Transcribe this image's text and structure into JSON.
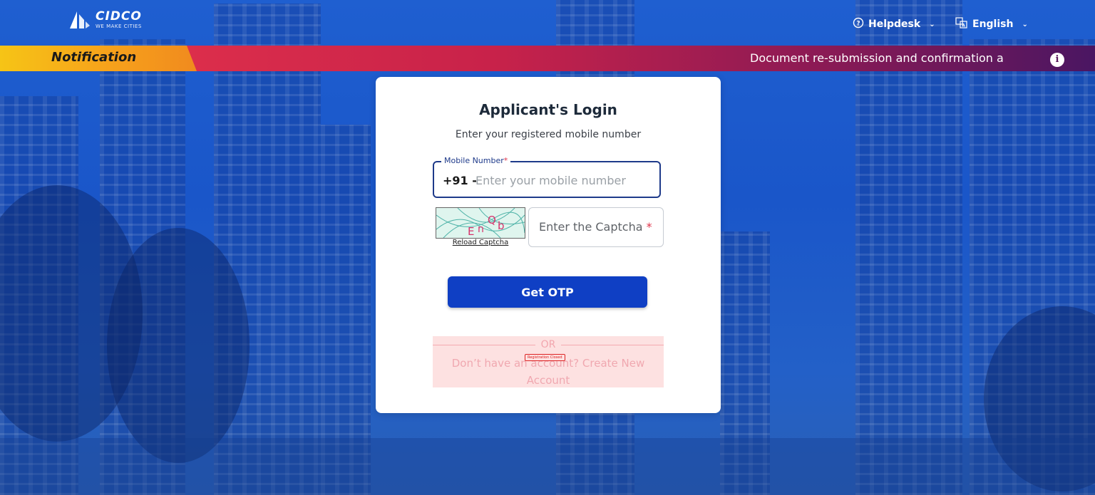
{
  "header": {
    "logo_title": "CIDCO",
    "logo_tagline": "WE MAKE CITIES",
    "helpdesk_label": "Helpdesk",
    "language_label": "English"
  },
  "notification": {
    "label": "Notification",
    "message": "Document re-submission and confirmation a"
  },
  "login": {
    "title": "Applicant's Login",
    "subtitle": "Enter your registered mobile number",
    "mobile_label": "Mobile Number",
    "required_mark": "*",
    "country_prefix": "+91 -",
    "mobile_placeholder": "Enter your mobile number",
    "captcha_text": "EnQb",
    "reload_captcha": "Reload Captcha",
    "captcha_placeholder": "Enter the Captcha",
    "get_otp": "Get OTP",
    "or_label": "OR",
    "signup_text": "Don’t have an account? Create New Account",
    "closed_badge": "Registration Closed"
  },
  "colors": {
    "primary": "#0f3fc4",
    "notification_start": "#e8354c",
    "notification_end": "#4a1662",
    "tag_yellow": "#f6c416",
    "required": "#e0334a"
  }
}
